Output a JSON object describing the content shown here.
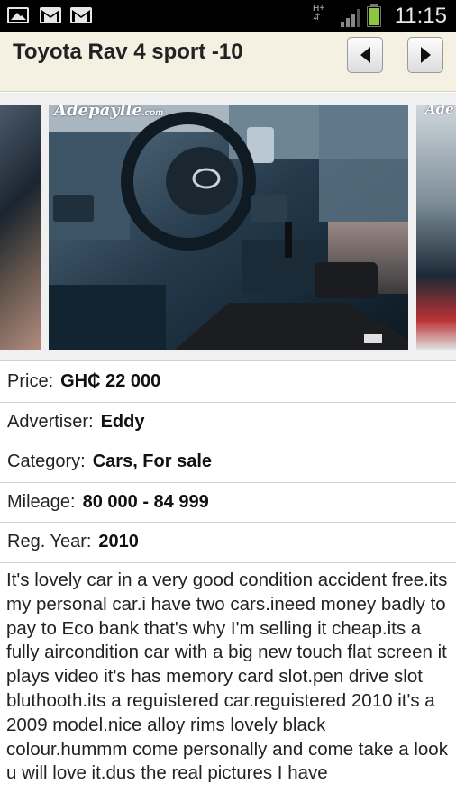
{
  "status_bar": {
    "network": "H+",
    "time": "11:15",
    "icons": [
      "gallery-icon",
      "gmail-icon",
      "gmail-icon",
      "signal-icon",
      "battery-icon"
    ]
  },
  "header": {
    "title": "Toyota Rav 4 sport -10",
    "prev_icon": "arrow-left-icon",
    "next_icon": "arrow-right-icon"
  },
  "gallery": {
    "watermark_main": "Adepaylle",
    "watermark_main_suffix": ".com",
    "watermark_right": "Ade"
  },
  "details": [
    {
      "label": "Price:",
      "value": "GH₵ 22 000"
    },
    {
      "label": "Advertiser:",
      "value": "Eddy"
    },
    {
      "label": "Category:",
      "value": "Cars, For sale"
    },
    {
      "label": "Mileage:",
      "value": "80 000 - 84 999"
    },
    {
      "label": "Reg. Year:",
      "value": "2010"
    }
  ],
  "description": "It's lovely car in a very good condition accident free.its my personal car.i have two cars.ineed money badly to pay to Eco bank that's why I'm selling it cheap.its a fully aircondition car with a big new touch flat screen it plays video it's has memory card slot.pen drive slot bluthooth.its a reguistered car.reguistered 2010 it's a 2009 model.nice alloy rims lovely black colour.hummm come personally and come take a look u will love it.dus the real pictures I have",
  "colors": {
    "header_bg": "#f4f1e2",
    "status_bg": "#000000",
    "battery": "#8cc63f"
  }
}
